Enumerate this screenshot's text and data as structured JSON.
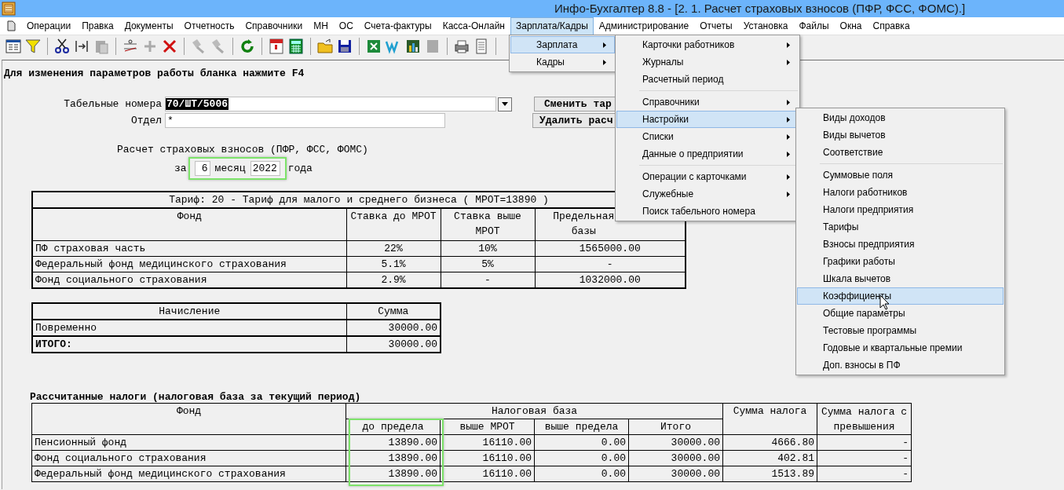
{
  "window": {
    "title": "Инфо-Бухгалтер 8.8 - [2. 1. Расчет страховых взносов (ПФР, ФСС, ФОМС).]"
  },
  "menu_bar": [
    {
      "label": "Операции",
      "selected": false
    },
    {
      "label": "Правка",
      "selected": false
    },
    {
      "label": "Документы",
      "selected": false
    },
    {
      "label": "Отчетность",
      "selected": false
    },
    {
      "label": "Справочники",
      "selected": false
    },
    {
      "label": "МН",
      "selected": false
    },
    {
      "label": "ОС",
      "selected": false
    },
    {
      "label": "Счета-фактуры",
      "selected": false
    },
    {
      "label": "Касса-Онлайн",
      "selected": false
    },
    {
      "label": "Зарплата/Кадры",
      "selected": true
    },
    {
      "label": "Администрирование",
      "selected": false
    },
    {
      "label": "Отчеты",
      "selected": false
    },
    {
      "label": "Установка",
      "selected": false
    },
    {
      "label": "Файлы",
      "selected": false
    },
    {
      "label": "Окна",
      "selected": false
    },
    {
      "label": "Справка",
      "selected": false
    }
  ],
  "menus": [
    {
      "items": [
        {
          "kind": "item",
          "label": "Зарплата",
          "submenu": true,
          "selected": true
        },
        {
          "kind": "item",
          "label": "Кадры",
          "submenu": true,
          "selected": false
        }
      ]
    },
    {
      "items": [
        {
          "kind": "item",
          "label": "Карточки работников",
          "submenu": true,
          "selected": false
        },
        {
          "kind": "item",
          "label": "Журналы",
          "submenu": true,
          "selected": false
        },
        {
          "kind": "item",
          "label": "Расчетный период",
          "submenu": false,
          "selected": false
        },
        {
          "kind": "separator"
        },
        {
          "kind": "item",
          "label": "Справочники",
          "submenu": true,
          "selected": false
        },
        {
          "kind": "item",
          "label": "Настройки",
          "submenu": true,
          "selected": true
        },
        {
          "kind": "item",
          "label": "Списки",
          "submenu": true,
          "selected": false
        },
        {
          "kind": "item",
          "label": "Данные о предприятии",
          "submenu": true,
          "selected": false
        },
        {
          "kind": "separator"
        },
        {
          "kind": "item",
          "label": "Операции с карточками",
          "submenu": true,
          "selected": false
        },
        {
          "kind": "item",
          "label": "Служебные",
          "submenu": true,
          "selected": false
        },
        {
          "kind": "item",
          "label": "Поиск табельного номера",
          "submenu": false,
          "selected": false
        }
      ]
    },
    {
      "items": [
        {
          "kind": "item",
          "label": "Виды доходов",
          "submenu": false,
          "selected": false
        },
        {
          "kind": "item",
          "label": "Виды вычетов",
          "submenu": false,
          "selected": false
        },
        {
          "kind": "item",
          "label": "Соответствие",
          "submenu": false,
          "selected": false
        },
        {
          "kind": "separator"
        },
        {
          "kind": "item",
          "label": "Суммовые поля",
          "submenu": false,
          "selected": false
        },
        {
          "kind": "item",
          "label": "Налоги работников",
          "submenu": false,
          "selected": false
        },
        {
          "kind": "item",
          "label": "Налоги предприятия",
          "submenu": false,
          "selected": false
        },
        {
          "kind": "item",
          "label": "Тарифы",
          "submenu": false,
          "selected": false
        },
        {
          "kind": "item",
          "label": "Взносы предприятия",
          "submenu": false,
          "selected": false
        },
        {
          "kind": "item",
          "label": "Графики работы",
          "submenu": false,
          "selected": false
        },
        {
          "kind": "item",
          "label": "Шкала вычетов",
          "submenu": false,
          "selected": false
        },
        {
          "kind": "item",
          "label": "Коэффициенты",
          "submenu": false,
          "selected": true
        },
        {
          "kind": "item",
          "label": "Общие параметры",
          "submenu": false,
          "selected": false
        },
        {
          "kind": "item",
          "label": "Тестовые программы",
          "submenu": false,
          "selected": false
        },
        {
          "kind": "item",
          "label": "Годовые и квартальные премии",
          "submenu": false,
          "selected": false
        },
        {
          "kind": "item",
          "label": "Доп. взносы в ПФ",
          "submenu": false,
          "selected": false
        }
      ]
    }
  ],
  "hint": "Для изменения параметров работы бланка нажмите F4",
  "form": {
    "employee_numbers": {
      "label": "Табельные номера",
      "value": "70/ШТ/5006"
    },
    "department": {
      "label": "Отдел",
      "value": "*"
    },
    "buttons": [
      "Сменить тар",
      "Удалить расч"
    ],
    "calc_title": "Расчет страховых взносов (ПФР, ФСС, ФОМС)",
    "period": {
      "prefix": "за",
      "month": "6",
      "month_label": "месяц",
      "year": "2022",
      "year_label": "года",
      "highlighted": true
    }
  },
  "tariff_table": {
    "title": "Тариф: 20 - Тариф для малого и среднего бизнеса ( МРОТ=13890 )",
    "columns": [
      "Фонд",
      "Ставка до МРОТ",
      "Ставка выше МРОТ",
      "Предельная базы"
    ],
    "rows": [
      [
        "ПФ страховая часть",
        "22%",
        "10%",
        "1565000.00"
      ],
      [
        "Федеральный фонд медицинского страхования",
        "5.1%",
        "5%",
        "-"
      ],
      [
        "Фонд социального страхования",
        "2.9%",
        "-",
        "1032000.00"
      ]
    ]
  },
  "accrual_table": {
    "columns": [
      "Начисление",
      "Сумма"
    ],
    "rows": [
      {
        "cells": [
          "Повременно",
          "30000.00"
        ],
        "total": false
      },
      {
        "cells": [
          "ИТОГО:",
          "30000.00"
        ],
        "total": true
      }
    ]
  },
  "taxes": {
    "caption": "Рассчитанные налоги (налоговая база за текущий период)",
    "fund_header": "Фонд",
    "base_header": "Налоговая база",
    "tax_header": "Сумма налога",
    "excess_header": [
      "Сумма налога с",
      "превышения"
    ],
    "base_columns": [
      {
        "label": "до предела",
        "highlighted": true
      },
      {
        "label": "выше МРОТ",
        "highlighted": false
      },
      {
        "label": "выше предела",
        "highlighted": false
      },
      {
        "label": "Итого",
        "highlighted": false
      }
    ],
    "rows": [
      [
        "Пенсионный фонд",
        "13890.00",
        "16110.00",
        "0.00",
        "30000.00",
        "4666.80",
        "-"
      ],
      [
        "Фонд социального страхования",
        "13890.00",
        "16110.00",
        "0.00",
        "30000.00",
        "402.81",
        "-"
      ],
      [
        "Федеральный фонд медицинского страхования",
        "13890.00",
        "16110.00",
        "0.00",
        "30000.00",
        "1513.89",
        "-"
      ]
    ]
  }
}
